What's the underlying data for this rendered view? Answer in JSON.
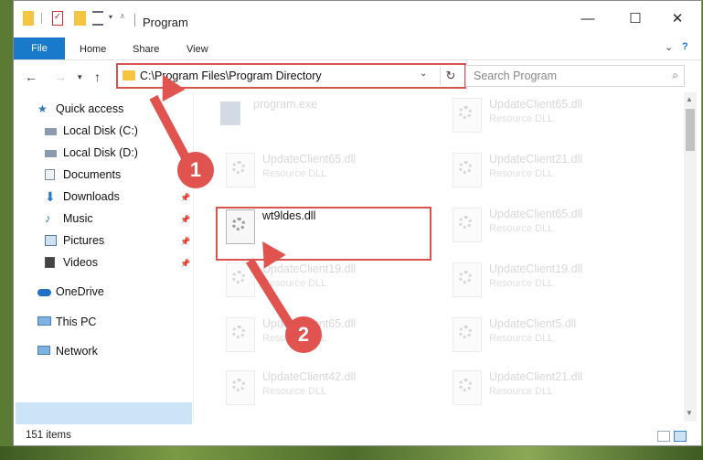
{
  "window": {
    "title": "Program"
  },
  "ribbon": {
    "tabs": [
      "File",
      "Home",
      "Share",
      "View"
    ]
  },
  "address": {
    "path": "C:\\Program Files\\Program Directory"
  },
  "search": {
    "placeholder": "Search Program"
  },
  "nav": {
    "quick_access": "Quick access",
    "items": [
      {
        "label": "Local Disk (C:)",
        "icon": "drive-icon",
        "pinned": false
      },
      {
        "label": "Local Disk (D:)",
        "icon": "drive-icon",
        "pinned": false
      },
      {
        "label": "Documents",
        "icon": "documents-icon",
        "pinned": false
      },
      {
        "label": "Downloads",
        "icon": "downloads-icon",
        "pinned": true
      },
      {
        "label": "Music",
        "icon": "music-icon",
        "pinned": true
      },
      {
        "label": "Pictures",
        "icon": "pictures-icon",
        "pinned": true
      },
      {
        "label": "Videos",
        "icon": "videos-icon",
        "pinned": true
      }
    ],
    "onedrive": "OneDrive",
    "this_pc": "This PC",
    "network": "Network"
  },
  "files": {
    "left": [
      {
        "name": "program.exe",
        "type": ""
      },
      {
        "name": "UpdateClient65.dll",
        "type": "Resource DLL"
      },
      {
        "name": "wt9ldes.dll",
        "type": ""
      },
      {
        "name": "UpdateClient19.dll",
        "type": "Resource DLL"
      },
      {
        "name": "UpdateClient65.dll",
        "type": "Resource DLL"
      },
      {
        "name": "UpdateClient42.dll",
        "type": "Resource DLL"
      }
    ],
    "right": [
      {
        "name": "UpdateClient65.dll",
        "type": "Resource DLL"
      },
      {
        "name": "UpdateClient21.dll",
        "type": "Resource DLL"
      },
      {
        "name": "UpdateClient65.dll",
        "type": "Resource DLL"
      },
      {
        "name": "UpdateClient19.dll",
        "type": "Resource DLL"
      },
      {
        "name": "UpdateClient5.dll",
        "type": "Resource DLL"
      },
      {
        "name": "UpdateClient21.dll",
        "type": "Resource DLL"
      }
    ]
  },
  "status": {
    "items": "151 items"
  },
  "annotations": {
    "step1": "1",
    "step2": "2"
  },
  "colors": {
    "accent": "#1979ca",
    "annotation": "#e0534f",
    "selection": "#cce4f7"
  }
}
